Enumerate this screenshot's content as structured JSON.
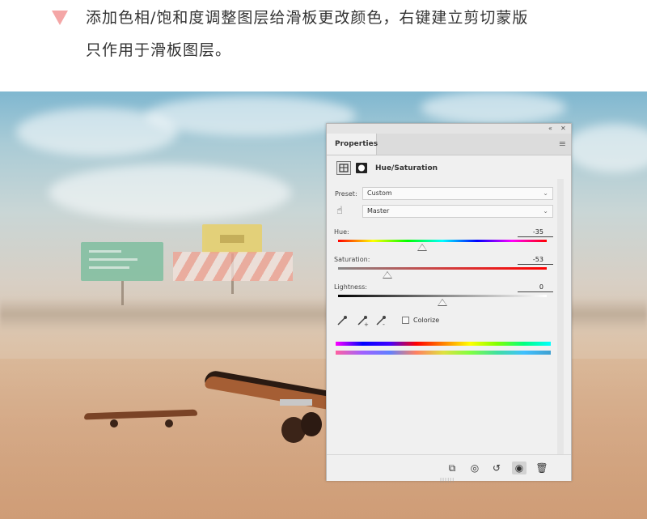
{
  "instruction": {
    "line1": "添加色相/饱和度调整图层给滑板更改颜色，右键建立剪切蒙版",
    "line2": "只作用于滑板图层。"
  },
  "panel": {
    "tab_label": "Properties",
    "collapse_glyph": "«",
    "close_glyph": "✕",
    "menu_glyph": "≡",
    "adjustment_title": "Hue/Saturation",
    "preset_label": "Preset:",
    "preset_value": "Custom",
    "channel_value": "Master",
    "hue_label": "Hue:",
    "hue_value": "-35",
    "saturation_label": "Saturation:",
    "saturation_value": "-53",
    "lightness_label": "Lightness:",
    "lightness_value": "0",
    "colorize_label": "Colorize",
    "colorize_checked": false,
    "slider_range": [
      -180,
      180
    ],
    "sat_range": [
      -100,
      100
    ],
    "light_range": [
      -100,
      100
    ],
    "hue_numeric": -35,
    "saturation_numeric": -53,
    "lightness_numeric": 0
  },
  "icons": {
    "hand": "☝",
    "eyedropper": "⁄",
    "clip": "⧉",
    "view_previous": "◎",
    "reset": "↺",
    "visibility": "◉",
    "delete": "🗑"
  },
  "colors": {
    "accent": "#f4a6a6",
    "panel_bg": "#f0f0f0"
  }
}
